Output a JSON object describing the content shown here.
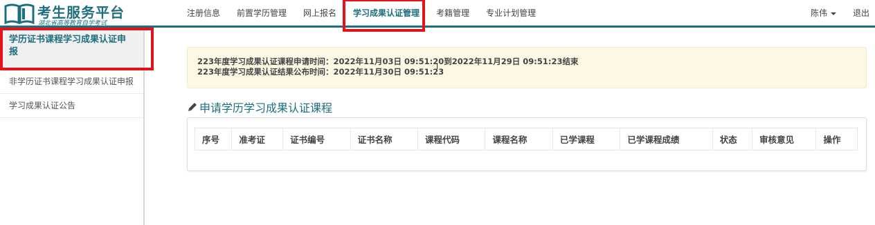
{
  "brand": {
    "title": "考生服务平台",
    "subtitle": "湖北省高等教育自学考试",
    "icon": "open-book-icon",
    "color": "#1e6f7e"
  },
  "nav": {
    "items": [
      {
        "label": "注册信息"
      },
      {
        "label": "前置学历管理"
      },
      {
        "label": "网上报名"
      },
      {
        "label": "学习成果认证管理"
      },
      {
        "label": "考籍管理"
      },
      {
        "label": "专业计划管理"
      }
    ],
    "user": "陈伟",
    "logout": "退出"
  },
  "sidebar": {
    "items": [
      {
        "label": "学历证书课程学习成果认证申报"
      },
      {
        "label": "非学历证书课程学习成果认证申报"
      },
      {
        "label": "学习成果认证公告"
      }
    ]
  },
  "notice": {
    "line1": "223年度学习成果认证课程申请时间：2022年11月03日 09:51:20到2022年11月29日 09:51:23结束",
    "line2": "223年度学习成果认证结果公布时间：2022年11月30日 09:51:23"
  },
  "section": {
    "title": "申请学历学习成果认证课程",
    "icon": "pencil-icon"
  },
  "table": {
    "headers": [
      "序号",
      "准考证",
      "证书编号",
      "证书名称",
      "课程代码",
      "课程名称",
      "已学课程",
      "已学课程成绩",
      "状态",
      "审核意见",
      "操作"
    ]
  },
  "colors": {
    "accent": "#1e6f7e",
    "highlight": "#e1141b",
    "notice_bg": "#fcf8e3"
  }
}
